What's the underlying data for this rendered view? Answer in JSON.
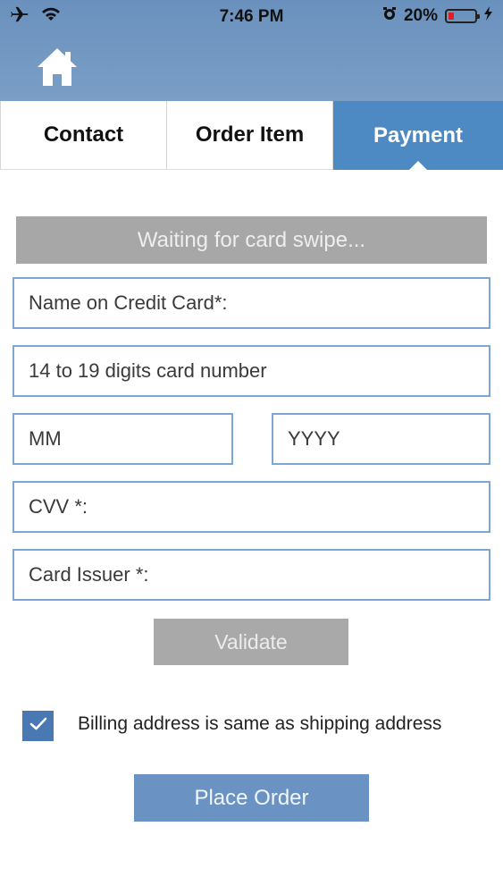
{
  "status_bar": {
    "time": "7:46 PM",
    "battery_percent": "20%",
    "icons": [
      "airplane-icon",
      "wifi-icon",
      "alarm-icon",
      "battery-icon",
      "charging-icon"
    ]
  },
  "header": {
    "home_icon": "home-icon"
  },
  "tabs": [
    {
      "label": "Contact",
      "active": false
    },
    {
      "label": "Order Item",
      "active": false
    },
    {
      "label": "Payment",
      "active": true
    }
  ],
  "payment": {
    "swipe_status": "Waiting for card swipe...",
    "name_placeholder": "Name  on Credit Card*:",
    "card_number_placeholder": "14 to 19 digits card number",
    "month_placeholder": "MM",
    "year_placeholder": "YYYY",
    "cvv_placeholder": "CVV *:",
    "issuer_placeholder": "Card Issuer *:",
    "validate_label": "Validate",
    "billing_same_label": "Billing address is same as shipping address",
    "billing_same_checked": true,
    "place_order_label": "Place Order"
  },
  "colors": {
    "header": "#7499c2",
    "active_tab": "#4d8ac3",
    "field_border": "#7da6d3",
    "checkbox": "#4978b3",
    "place_order": "#6a93c3",
    "disabled": "#a9a9a9"
  }
}
